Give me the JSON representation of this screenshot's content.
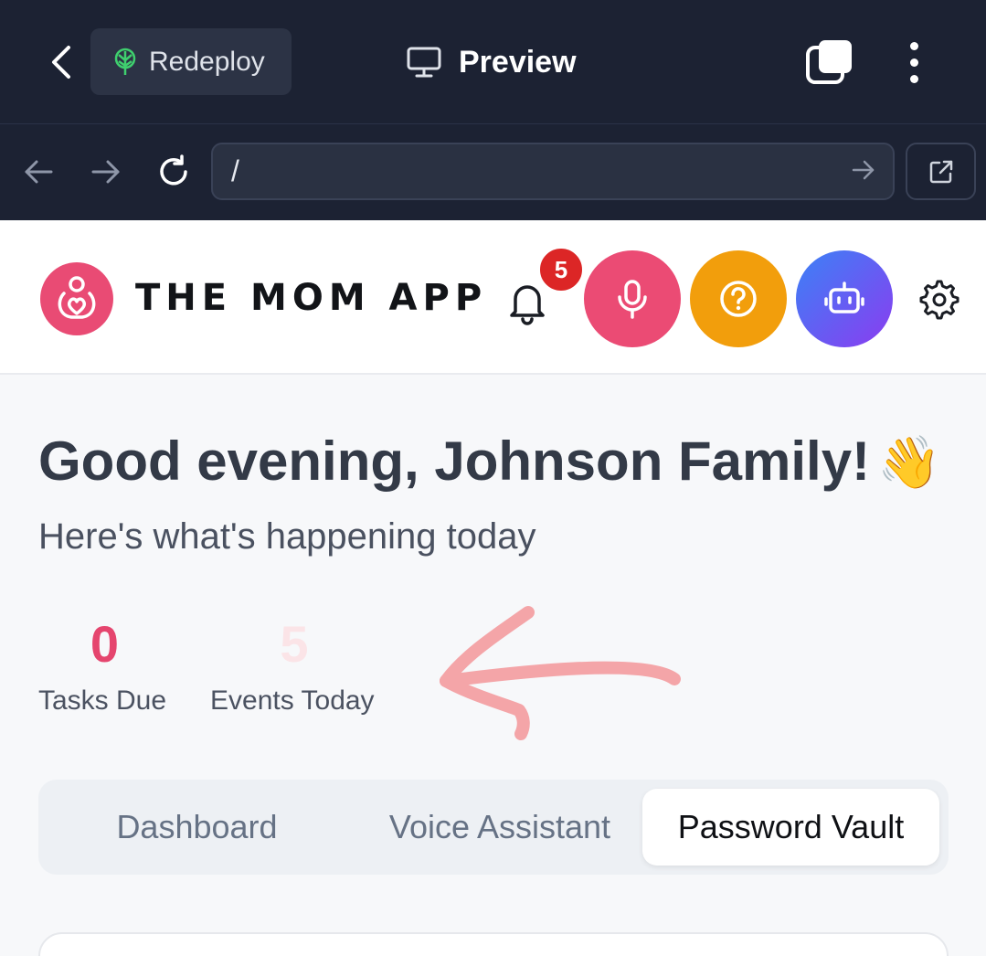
{
  "browser": {
    "redeploy_label": "Redeploy",
    "preview_label": "Preview",
    "address_value": "/"
  },
  "app": {
    "title": "THE MOM APP",
    "notification_count": "5",
    "colors": {
      "brand": "#e94b74",
      "mic": "#eb4b74",
      "help": "#f29e0c",
      "bot_gradient": [
        "#3b82f6",
        "#8b3cf0"
      ],
      "badge": "#dc2626"
    }
  },
  "main": {
    "greeting": "Good evening, Johnson Family!",
    "greeting_emoji": "👋",
    "subtitle": "Here's what's happening today",
    "stats": [
      {
        "value": "0",
        "label": "Tasks Due"
      },
      {
        "value": "5",
        "label": "Events Today"
      }
    ],
    "tabs": [
      {
        "label": "Dashboard",
        "active": false
      },
      {
        "label": "Voice Assistant",
        "active": false
      },
      {
        "label": "Password Vault",
        "active": true
      }
    ]
  },
  "icons": {
    "back": "chevron-left-icon",
    "redeploy": "tree-icon",
    "preview": "monitor-icon",
    "tabs": "tabs-icon",
    "more": "more-vertical-icon",
    "nav_back": "arrow-left-icon",
    "nav_forward": "arrow-right-icon",
    "reload": "reload-icon",
    "go": "arrow-right-icon",
    "open_external": "external-link-icon",
    "logo": "mother-heart-logo",
    "bell": "bell-icon",
    "mic": "mic-icon",
    "help": "help-circle-icon",
    "bot": "robot-icon",
    "settings": "gear-icon"
  }
}
